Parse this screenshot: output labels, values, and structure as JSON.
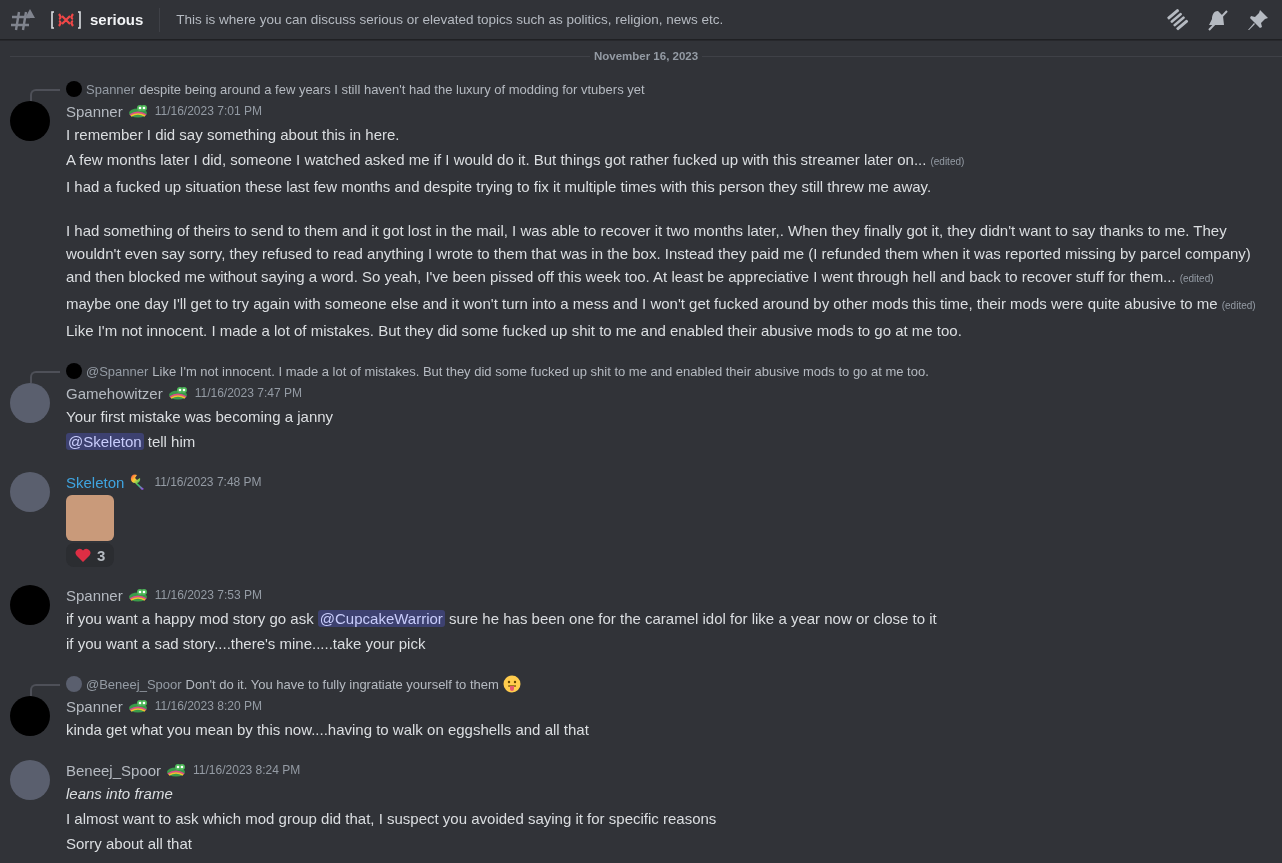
{
  "header": {
    "channel_name": "serious",
    "topic": "This is where you can discuss serious or elevated topics such as politics, religion, news etc."
  },
  "date_divider": "November 16, 2023",
  "messages": [
    {
      "author": "Spanner",
      "color": "#b5bac1",
      "avatar": {
        "kind": "blank"
      },
      "badge": {
        "kind": "frog"
      },
      "timestamp": "11/16/2023 7:01 PM",
      "reply": {
        "author": "Spanner",
        "avatar": {
          "kind": "blank"
        },
        "text": "despite being around a few years I still haven't had the luxury of modding for vtubers yet"
      },
      "lines": [
        {
          "kind": "text",
          "segments": [
            {
              "kind": "text",
              "text": "I remember I did say something about this in here."
            }
          ]
        },
        {
          "kind": "text",
          "segments": [
            {
              "kind": "text",
              "text": "A few months later I did, someone I watched asked me if I would do it. But things got rather fucked up with this streamer later on..."
            }
          ],
          "edited": "(edited)"
        },
        {
          "kind": "text",
          "segments": [
            {
              "kind": "text",
              "text": "I had a fucked up situation these last few months and despite trying to fix it multiple times with this person they still threw me away."
            }
          ]
        },
        {
          "kind": "blank"
        },
        {
          "kind": "text",
          "segments": [
            {
              "kind": "text",
              "text": "I had something of theirs to send to them and it got lost in the mail, I was able to recover it two months later,. When they finally got it, they didn't want to say thanks to me. They wouldn't even say sorry, they refused to read anything I wrote to them that was in the box. Instead they paid me (I refunded them when it was reported missing by parcel company) and then blocked me without saying a word. So yeah, I've been pissed off this week too. At least be appreciative I went through hell and back to recover stuff for them..."
            }
          ],
          "edited": "(edited)"
        },
        {
          "kind": "text",
          "segments": [
            {
              "kind": "text",
              "text": "maybe one day I'll get to try again with someone else and it won't turn into a mess and I won't get fucked around by other mods this time, their mods were quite abusive to me"
            }
          ],
          "edited": "(edited)"
        },
        {
          "kind": "text",
          "segments": [
            {
              "kind": "text",
              "text": "Like I'm not innocent. I made a lot of mistakes. But they did some fucked up shit to me and enabled their abusive mods to go at me too."
            }
          ]
        }
      ]
    },
    {
      "author": "Gamehowitzer",
      "color": "#b5bac1",
      "avatar": {
        "kind": "photo"
      },
      "badge": {
        "kind": "frog"
      },
      "timestamp": "11/16/2023 7:47 PM",
      "reply": {
        "author": "@Spanner",
        "avatar": {
          "kind": "blank"
        },
        "text": "Like I'm not innocent. I made a lot of mistakes. But they did some fucked up shit to me and enabled their abusive mods to go at me too."
      },
      "lines": [
        {
          "kind": "text",
          "segments": [
            {
              "kind": "text",
              "text": "Your first mistake was becoming a janny"
            }
          ]
        },
        {
          "kind": "text",
          "segments": [
            {
              "kind": "mention",
              "text": "@Skeleton"
            },
            {
              "kind": "text",
              "text": " tell him"
            }
          ]
        }
      ]
    },
    {
      "author": "Skeleton",
      "color": "#3fa4e0",
      "avatar": {
        "kind": "photo"
      },
      "badge": {
        "kind": "wrench"
      },
      "timestamp": "11/16/2023 7:48 PM",
      "lines": [
        {
          "kind": "sticker"
        }
      ],
      "reactions": [
        {
          "count": "3",
          "selected": false
        }
      ]
    },
    {
      "author": "Spanner",
      "color": "#b5bac1",
      "avatar": {
        "kind": "blank"
      },
      "badge": {
        "kind": "frog"
      },
      "timestamp": "11/16/2023 7:53 PM",
      "lines": [
        {
          "kind": "text",
          "segments": [
            {
              "kind": "text",
              "text": "if you want a happy mod story go ask "
            },
            {
              "kind": "mention",
              "text": "@CupcakeWarrior"
            },
            {
              "kind": "text",
              "text": " sure he has been one for the caramel idol for like a year now or close to it"
            }
          ]
        },
        {
          "kind": "text",
          "segments": [
            {
              "kind": "text",
              "text": "if you want a sad story....there's mine.....take your pick"
            }
          ]
        }
      ]
    },
    {
      "author": "Spanner",
      "color": "#b5bac1",
      "avatar": {
        "kind": "blank"
      },
      "badge": {
        "kind": "frog"
      },
      "timestamp": "11/16/2023 8:20 PM",
      "reply": {
        "author": "@Beneej_Spoor",
        "avatar": {
          "kind": "photo"
        },
        "text": "Don't do it. You have to fully ingratiate yourself to them",
        "emoji": {
          "kind": "tongue"
        }
      },
      "lines": [
        {
          "kind": "text",
          "segments": [
            {
              "kind": "text",
              "text": "kinda get what you mean by this now....having to walk on eggshells and all that"
            }
          ]
        }
      ]
    },
    {
      "author": "Beneej_Spoor",
      "color": "#b5bac1",
      "avatar": {
        "kind": "photo"
      },
      "badge": {
        "kind": "frog"
      },
      "timestamp": "11/16/2023 8:24 PM",
      "lines": [
        {
          "kind": "italic",
          "segments": [
            {
              "kind": "text",
              "text": "leans into frame"
            }
          ]
        },
        {
          "kind": "text",
          "segments": [
            {
              "kind": "text",
              "text": "I almost want to ask which mod group did that, I suspect you avoided saying it for specific reasons"
            }
          ]
        },
        {
          "kind": "text",
          "segments": [
            {
              "kind": "text",
              "text": "Sorry about all that"
            }
          ]
        }
      ]
    }
  ]
}
